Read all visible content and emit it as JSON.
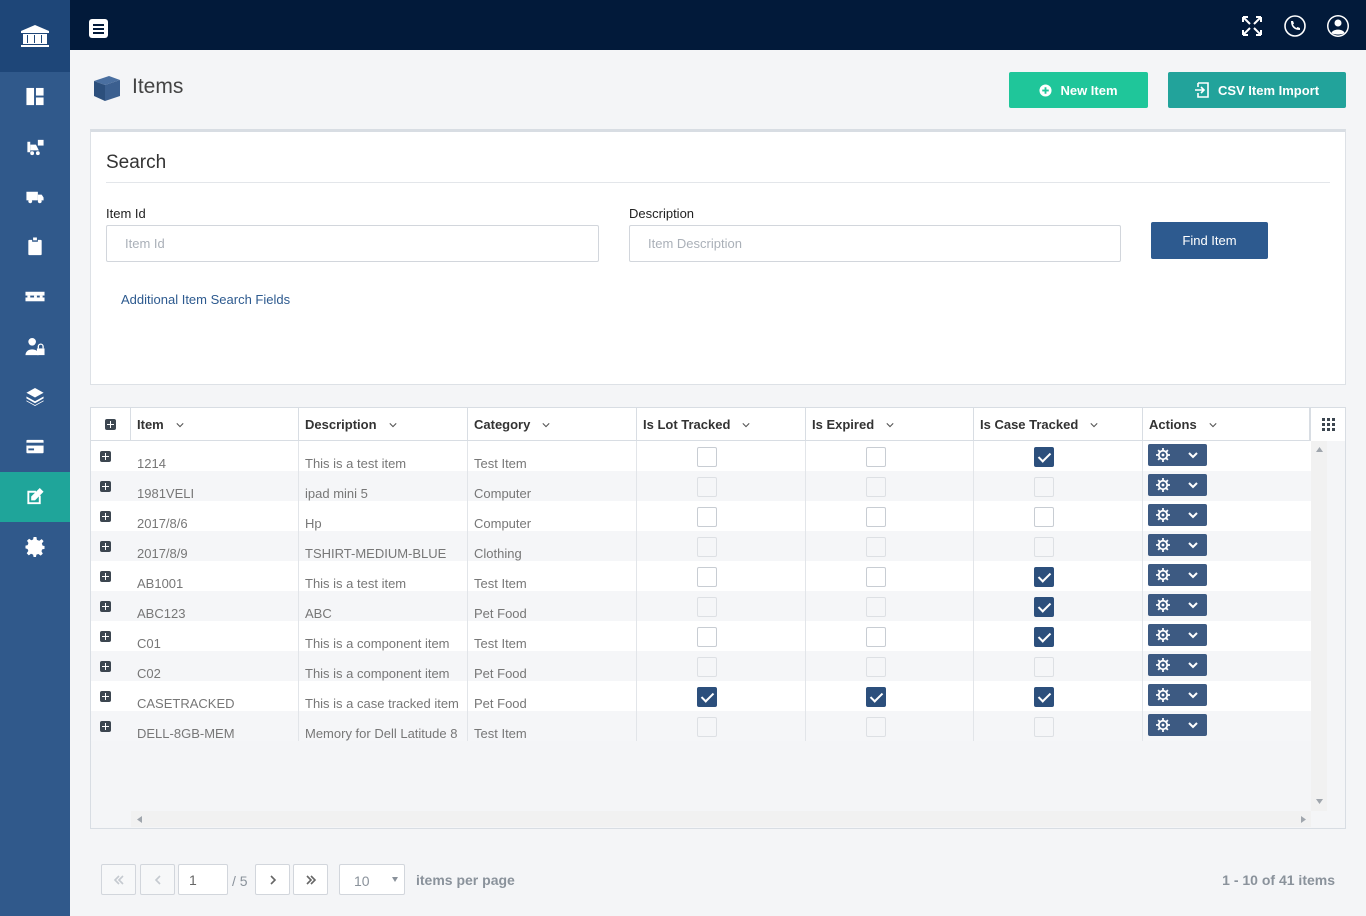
{
  "sidebar": {
    "items": [
      {
        "name": "dashboard-icon",
        "active": false
      },
      {
        "name": "forklift-icon",
        "active": false
      },
      {
        "name": "truck-icon",
        "active": false
      },
      {
        "name": "clipboard-icon",
        "active": false
      },
      {
        "name": "pallet-icon",
        "active": false
      },
      {
        "name": "user-lock-icon",
        "active": false
      },
      {
        "name": "layers-icon",
        "active": false
      },
      {
        "name": "credit-card-icon",
        "active": false
      },
      {
        "name": "edit-icon",
        "active": true
      },
      {
        "name": "gear-icon",
        "active": false
      }
    ]
  },
  "header": {
    "title": "Items",
    "new_item_label": "New Item",
    "csv_import_label": "CSV Item Import"
  },
  "search": {
    "title": "Search",
    "item_id_label": "Item Id",
    "item_id_placeholder": "Item Id",
    "item_id_value": "",
    "description_label": "Description",
    "description_placeholder": "Item Description",
    "description_value": "",
    "find_label": "Find Item",
    "additional_link": "Additional Item Search Fields"
  },
  "grid": {
    "columns": [
      "Item",
      "Description",
      "Category",
      "Is Lot Tracked",
      "Is Expired",
      "Is Case Tracked",
      "Actions"
    ],
    "rows": [
      {
        "item": "1214",
        "description": "This is a test item",
        "category": "Test Item",
        "lot": false,
        "expired": false,
        "case": true
      },
      {
        "item": "1981VELI",
        "description": "ipad mini 5",
        "category": "Computer",
        "lot": false,
        "expired": false,
        "case": false
      },
      {
        "item": "2017/8/6",
        "description": "Hp",
        "category": "Computer",
        "lot": false,
        "expired": false,
        "case": false
      },
      {
        "item": "2017/8/9",
        "description": "TSHIRT-MEDIUM-BLUE",
        "category": "Clothing",
        "lot": false,
        "expired": false,
        "case": false
      },
      {
        "item": "AB1001",
        "description": "This is a test item",
        "category": "Test Item",
        "lot": false,
        "expired": false,
        "case": true
      },
      {
        "item": "ABC123",
        "description": "ABC",
        "category": "Pet Food",
        "lot": false,
        "expired": false,
        "case": true
      },
      {
        "item": "C01",
        "description": "This is a component item",
        "category": "Test Item",
        "lot": false,
        "expired": false,
        "case": true
      },
      {
        "item": "C02",
        "description": "This is a component item",
        "category": "Pet Food",
        "lot": false,
        "expired": false,
        "case": false
      },
      {
        "item": "CASETRACKED",
        "description": "This is a case tracked item",
        "category": "Pet Food",
        "lot": true,
        "expired": true,
        "case": true
      },
      {
        "item": "DELL-8GB-MEM",
        "description": "Memory for Dell Latitude 8",
        "category": "Test Item",
        "lot": false,
        "expired": false,
        "case": false
      }
    ]
  },
  "pager": {
    "current_page": "1",
    "of_label": "/ 5",
    "page_size": "10",
    "per_page_label": "items per page",
    "info": "1 - 10 of 41 items"
  }
}
